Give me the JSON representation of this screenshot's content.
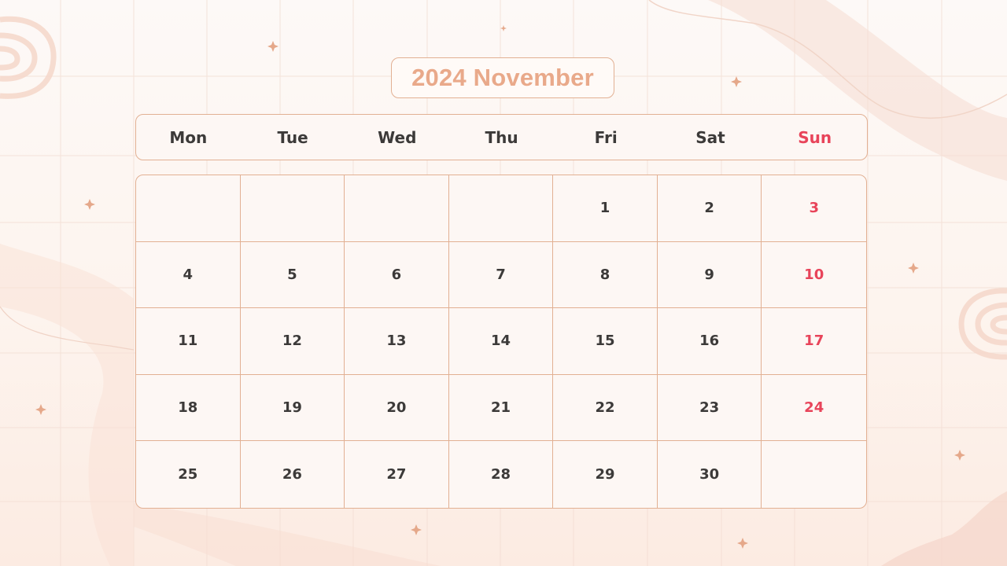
{
  "calendar": {
    "title": "2024 November",
    "weekdays": [
      "Mon",
      "Tue",
      "Wed",
      "Thu",
      "Fri",
      "Sat",
      "Sun"
    ],
    "weeks": [
      [
        "",
        "",
        "",
        "",
        "1",
        "2",
        "3"
      ],
      [
        "4",
        "5",
        "6",
        "7",
        "8",
        "9",
        "10"
      ],
      [
        "11",
        "12",
        "13",
        "14",
        "15",
        "16",
        "17"
      ],
      [
        "18",
        "19",
        "20",
        "21",
        "22",
        "23",
        "24"
      ],
      [
        "25",
        "26",
        "27",
        "28",
        "29",
        "30",
        ""
      ]
    ]
  },
  "colors": {
    "accent": "#e9a98a",
    "border": "#e2b093",
    "sunday": "#e8445a",
    "text": "#3c3a39"
  },
  "decorations": {
    "sparkle_icon": "four-point-star",
    "swirl_icon": "wood-ring-swirl"
  }
}
